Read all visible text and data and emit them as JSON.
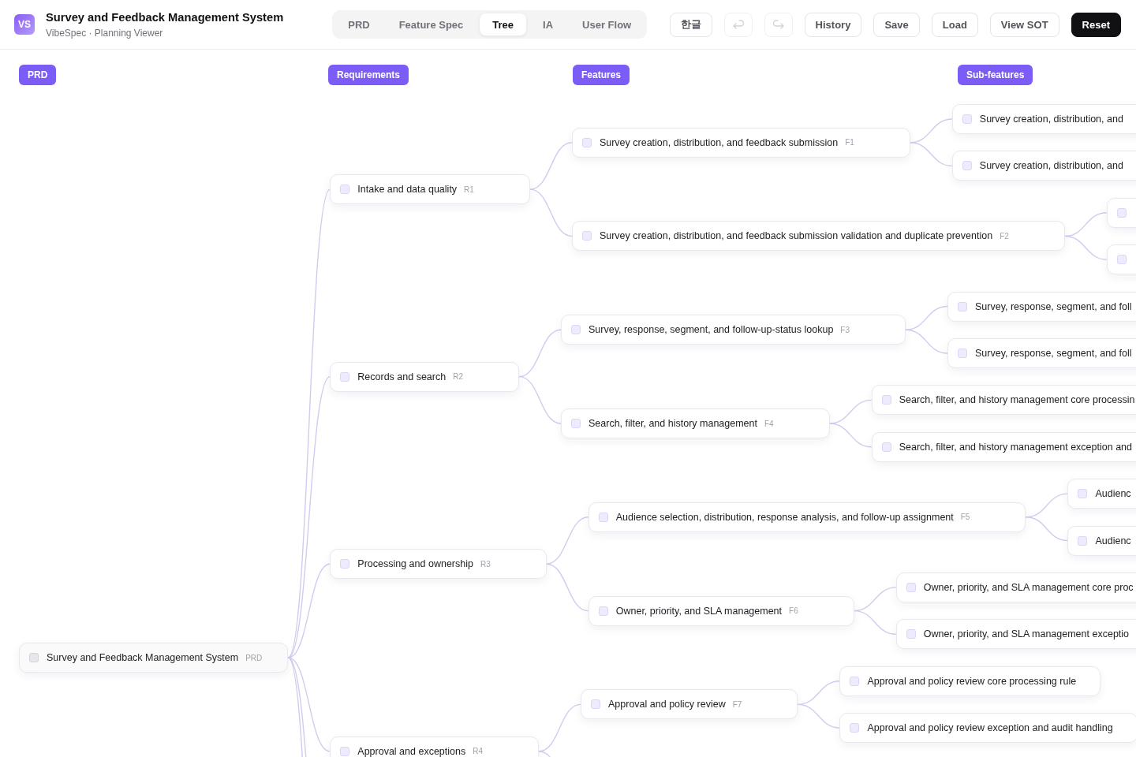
{
  "header": {
    "logo": "VS",
    "title": "Survey and Feedback Management System",
    "subtitle": "VibeSpec · Planning Viewer"
  },
  "tabs": [
    {
      "label": "PRD",
      "selected": false
    },
    {
      "label": "Feature Spec",
      "selected": false
    },
    {
      "label": "Tree",
      "selected": true
    },
    {
      "label": "IA",
      "selected": false
    },
    {
      "label": "User Flow",
      "selected": false
    }
  ],
  "toolbar": [
    {
      "kind": "text",
      "label": "한글",
      "disabled": false
    },
    {
      "kind": "undo",
      "disabled": true
    },
    {
      "kind": "redo",
      "disabled": true
    },
    {
      "kind": "text",
      "label": "History",
      "disabled": false
    },
    {
      "kind": "text",
      "label": "Save",
      "disabled": false
    },
    {
      "kind": "text",
      "label": "Load",
      "disabled": false
    },
    {
      "kind": "text",
      "label": "View SOT",
      "disabled": false
    },
    {
      "kind": "primary",
      "label": "Reset",
      "disabled": false
    }
  ],
  "columns": [
    "PRD",
    "Requirements",
    "Features",
    "Sub-features"
  ],
  "tree": {
    "label": "Survey and Feedback Management System",
    "tag": "PRD",
    "checked": false,
    "continues_below": true,
    "children": [
      {
        "label": "Intake and data quality",
        "tag": "R1",
        "checked": false,
        "children": [
          {
            "label": "Survey creation, distribution, and feedback submission",
            "tag": "F1",
            "checked": false,
            "children": [
              {
                "label": "Survey creation, distribution, and",
                "checked": false
              },
              {
                "label": "Survey creation, distribution, and",
                "checked": false
              }
            ]
          },
          {
            "label": "Survey creation, distribution, and feedback submission validation and duplicate prevention",
            "tag": "F2",
            "checked": false,
            "children": [
              {
                "checked": false
              },
              {
                "checked": false
              }
            ]
          }
        ]
      },
      {
        "label": "Records and search",
        "tag": "R2",
        "checked": false,
        "children": [
          {
            "label": "Survey, response, segment, and follow-up-status lookup",
            "tag": "F3",
            "checked": false,
            "children": [
              {
                "label": "Survey, response, segment, and foll",
                "checked": false
              },
              {
                "label": "Survey, response, segment, and foll",
                "checked": false
              }
            ]
          },
          {
            "label": "Search, filter, and history management",
            "tag": "F4",
            "checked": false,
            "children": [
              {
                "label": "Search, filter, and history management core processin",
                "checked": false
              },
              {
                "label": "Search, filter, and history management exception and",
                "checked": false
              }
            ]
          }
        ]
      },
      {
        "label": "Processing and ownership",
        "tag": "R3",
        "checked": false,
        "children": [
          {
            "label": "Audience selection, distribution, response analysis, and follow-up assignment",
            "tag": "F5",
            "checked": false,
            "children": [
              {
                "label": "Audienc",
                "checked": false
              },
              {
                "label": "Audienc",
                "checked": false
              }
            ]
          },
          {
            "label": "Owner, priority, and SLA management",
            "tag": "F6",
            "checked": false,
            "children": [
              {
                "label": "Owner, priority, and SLA management core proc",
                "checked": false
              },
              {
                "label": "Owner, priority, and SLA management exceptio",
                "checked": false
              }
            ]
          }
        ]
      },
      {
        "label": "Approval and exceptions",
        "tag": "R4",
        "checked": false,
        "continues_below": true,
        "children": [
          {
            "label": "Approval and policy review",
            "tag": "F7",
            "checked": false,
            "children": [
              {
                "label": "Approval and policy review core processing rule",
                "checked": false
              },
              {
                "label": "Approval and policy review exception and audit handling",
                "checked": false
              }
            ]
          }
        ]
      }
    ]
  }
}
